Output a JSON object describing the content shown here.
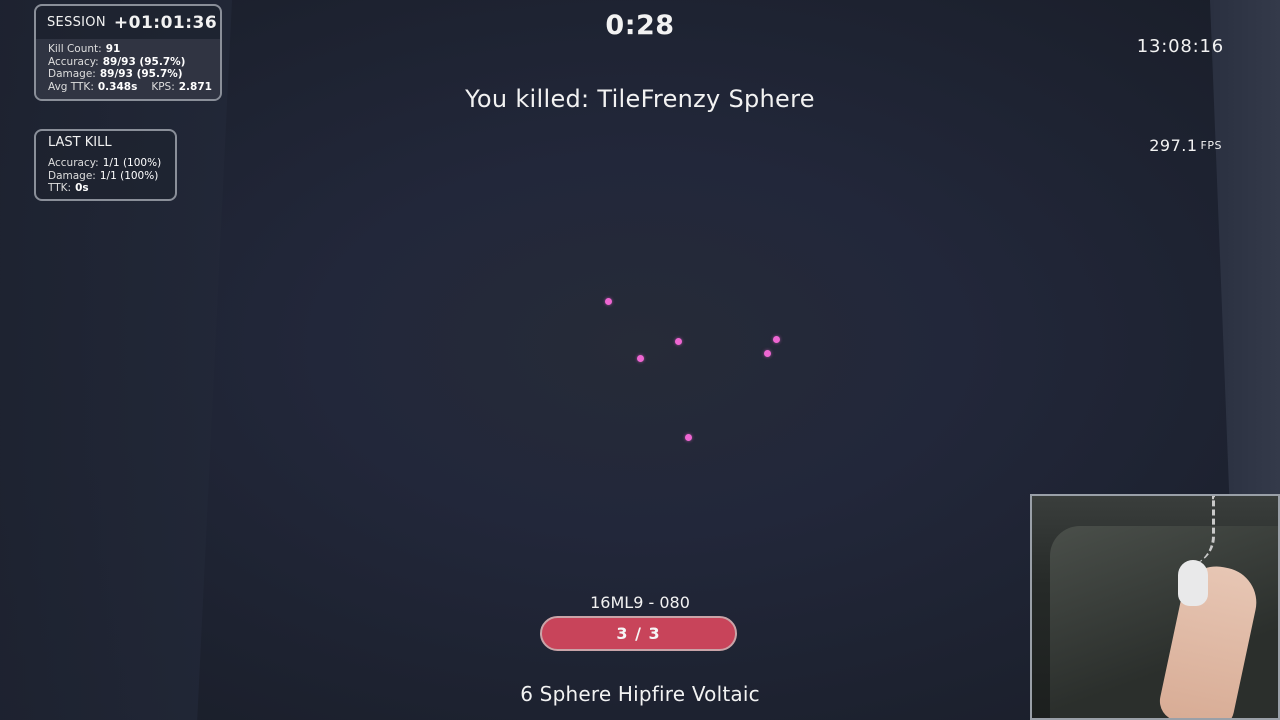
{
  "session": {
    "title": "SESSION",
    "elapsed": "+01:01:36",
    "kill_count_label": "Kill Count:",
    "kill_count": "91",
    "accuracy_label": "Accuracy:",
    "accuracy": "89/93 (95.7%)",
    "damage_label": "Damage:",
    "damage": "89/93 (95.7%)",
    "avg_ttk_label": "Avg TTK:",
    "avg_ttk": "0.348s",
    "kps_label": "KPS:",
    "kps": "2.871"
  },
  "last_kill": {
    "title": "LAST KILL",
    "accuracy_label": "Accuracy:",
    "accuracy": "1/1 (100%)",
    "damage_label": "Damage:",
    "damage": "1/1 (100%)",
    "ttk_label": "TTK:",
    "ttk": "0s"
  },
  "timer": "0:28",
  "clock": "13:08:16",
  "fps": {
    "value": "297.1",
    "unit": "FPS"
  },
  "kill_message": "You killed: TileFrenzy Sphere",
  "targets": {
    "count": 6,
    "color": "#ee66d2"
  },
  "progress": {
    "code": "16ML9 - 080",
    "label": "3 / 3",
    "fill": 1.0,
    "color": "#c8445a"
  },
  "scenario_name": "6 Sphere Hipfire Voltaic",
  "webcam": {
    "icon": "webcam-hand-mouse-icon"
  }
}
